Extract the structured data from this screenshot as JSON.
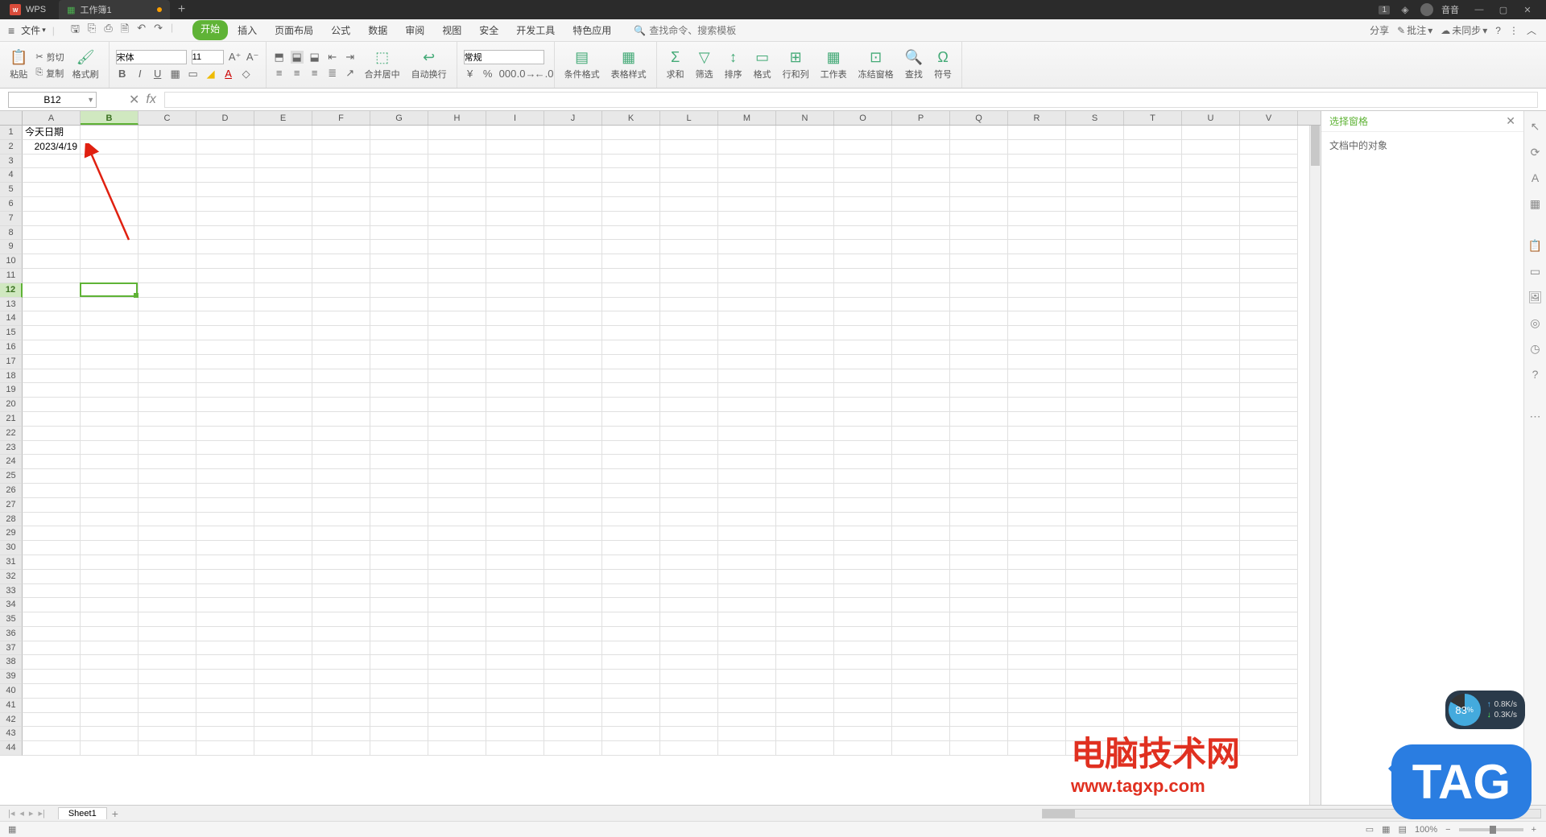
{
  "titlebar": {
    "app": "WPS",
    "doc_tab": "工作簿1",
    "badge": "1",
    "user": "音音"
  },
  "menubar": {
    "file": "文件",
    "tabs": [
      "开始",
      "插入",
      "页面布局",
      "公式",
      "数据",
      "审阅",
      "视图",
      "安全",
      "开发工具",
      "特色应用"
    ],
    "search_placeholder": "查找命令、搜索模板",
    "share": "分享",
    "annotate": "批注",
    "unsync": "未同步"
  },
  "ribbon": {
    "paste": "粘贴",
    "cut": "剪切",
    "copy": "复制",
    "format_painter": "格式刷",
    "font_name": "宋体",
    "font_size": "11",
    "merge_center": "合并居中",
    "wrap_text": "自动换行",
    "number_format": "常规",
    "cond_fmt": "条件格式",
    "table_style": "表格样式",
    "sum": "求和",
    "filter": "筛选",
    "sort": "排序",
    "format": "格式",
    "rowcol": "行和列",
    "worksheet": "工作表",
    "freeze": "冻结窗格",
    "find": "查找",
    "symbol": "符号"
  },
  "fbar": {
    "namebox": "B12",
    "formula": ""
  },
  "grid": {
    "columns": [
      "A",
      "B",
      "C",
      "D",
      "E",
      "F",
      "G",
      "H",
      "I",
      "J",
      "K",
      "L",
      "M",
      "N",
      "O",
      "P",
      "Q",
      "R",
      "S",
      "T",
      "U",
      "V"
    ],
    "selected_col": "B",
    "selected_row": 12,
    "cells": {
      "A1": "今天日期",
      "A2": "2023/4/19"
    },
    "row_count": 44
  },
  "rightpane": {
    "title": "选择窗格",
    "subtitle": "文档中的对象"
  },
  "sheettabs": {
    "active": "Sheet1"
  },
  "statusbar": {
    "zoom": "100%"
  },
  "gauge": {
    "percent": "83",
    "percent_suffix": "%",
    "up": "0.8K/s",
    "down": "0.3K/s"
  },
  "watermark": {
    "line1": "电脑技术网",
    "line2": "www.tagxp.com",
    "tag": "TAG"
  }
}
